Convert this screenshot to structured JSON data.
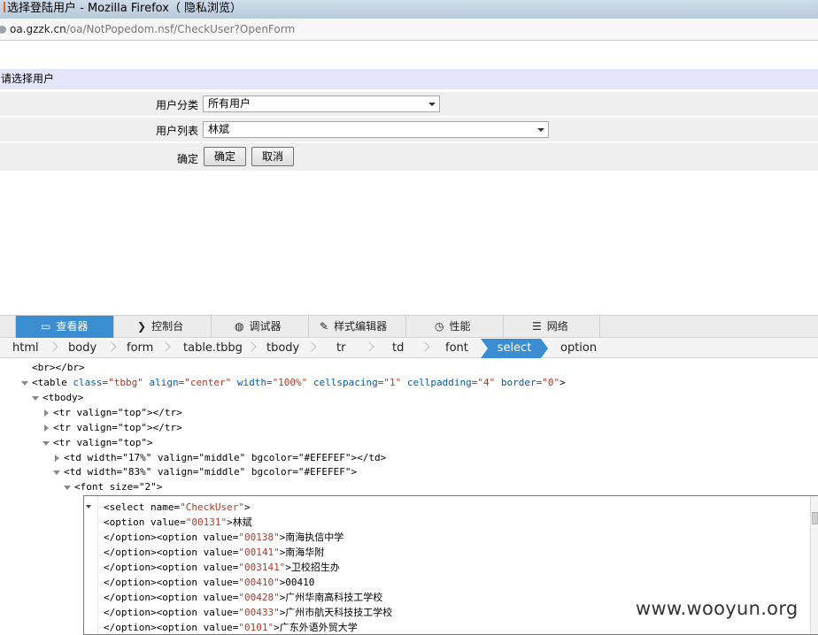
{
  "window": {
    "title": "选择登陆用户 - Mozilla Firefox（ 隐私浏览）",
    "url_domain": "oa.gzzk.cn",
    "url_path": "/oa/NotPopedom.nsf/CheckUser?OpenForm"
  },
  "form": {
    "header": "请选择用户",
    "category_label": "用户分类",
    "category_value": "所有用户",
    "list_label": "用户列表",
    "list_value": "林斌",
    "confirm_label": "确定",
    "confirm_button": "确定",
    "cancel_button": "取消"
  },
  "devtools": {
    "tabs": [
      {
        "icon": "inspector-icon",
        "label": "查看器"
      },
      {
        "icon": "console-icon",
        "label": "控制台"
      },
      {
        "icon": "debugger-icon",
        "label": "调试器"
      },
      {
        "icon": "style-editor-icon",
        "label": "样式编辑器"
      },
      {
        "icon": "performance-icon",
        "label": "性能"
      },
      {
        "icon": "network-icon",
        "label": "网络"
      }
    ],
    "breadcrumbs": [
      "html",
      "body",
      "form",
      "table.tbbg",
      "tbody",
      "tr",
      "td",
      "font",
      "select",
      "option"
    ],
    "markup": [
      "<br></br>",
      "<table",
      "<tbody>",
      "<tr valign=\"top\"></tr>",
      "<tr valign=\"top\"></tr>",
      "<tr valign=\"top\">",
      "<td width=\"17%\" valign=\"middle\" bgcolor=\"#EFEFEF\"></td>",
      "<td width=\"83%\" valign=\"middle\" bgcolor=\"#EFEFEF\">",
      "<font size=\"2\">"
    ],
    "table_line": {
      "tag": "<table",
      "class_attr": " class=",
      "class_val": "\"tbbg\"",
      "align_attr": " align=",
      "align_val": "\"center\"",
      "width_attr": " width=",
      "width_val": "\"100%\"",
      "cs_attr": " cellspacing=",
      "cs_val": "\"1\"",
      "cp_attr": " cellpadding=",
      "cp_val": "\"4\"",
      "border_attr": " border=",
      "border_val": "\"0\"",
      "close": ">"
    },
    "editor_lines": [
      {
        "pre": "<select name=",
        "val": "\"CheckUser\"",
        "post": ">"
      },
      {
        "pre": "<option value=",
        "val": "\"00131\"",
        "post": ">林斌"
      },
      {
        "pre": "</option><option value=",
        "val": "\"00138\"",
        "post": ">南海执信中学"
      },
      {
        "pre": "</option><option value=",
        "val": "\"00141\"",
        "post": ">南海华附"
      },
      {
        "pre": "</option><option value=",
        "val": "\"003141\"",
        "post": ">卫校招生办"
      },
      {
        "pre": "</option><option value=",
        "val": "\"00410\"",
        "post": ">00410"
      },
      {
        "pre": "</option><option value=",
        "val": "\"00428\"",
        "post": ">广州华南高科技工学校"
      },
      {
        "pre": "</option><option value=",
        "val": "\"00433\"",
        "post": ">广州市航天科技技工学校"
      },
      {
        "pre": "</option><option value=",
        "val": "\"0101\"",
        "post": ">广东外语外贸大学"
      }
    ]
  },
  "watermark": "www.wooyun.org",
  "colors": {
    "header_bg": "#e6e6fa",
    "row_bg": "#efefef",
    "devtools_accent": "#3a8dd0"
  }
}
